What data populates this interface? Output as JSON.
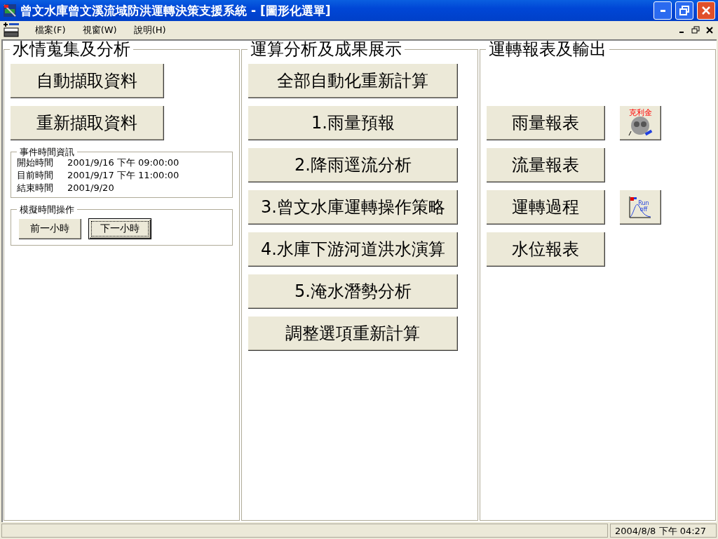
{
  "window": {
    "title": "曾文水庫曾文溪流域防洪運轉決策支援系統 - [圖形化選單]"
  },
  "menu": [
    {
      "label": "檔案(F)"
    },
    {
      "label": "視窗(W)"
    },
    {
      "label": "說明(H)"
    }
  ],
  "data_panel": {
    "title": "水情蒐集及分析",
    "buttons": [
      "自動擷取資料",
      "重新擷取資料"
    ],
    "event_info": {
      "title": "事件時間資訊",
      "rows": [
        {
          "label": "開始時間",
          "value": "2001/9/16 下午 09:00:00"
        },
        {
          "label": "目前時間",
          "value": "2001/9/17 下午 11:00:00"
        },
        {
          "label": "結束時間",
          "value": "2001/9/20"
        }
      ]
    },
    "simulation": {
      "title": "模擬時間操作",
      "buttons": [
        {
          "label": "前一小時",
          "focused": false
        },
        {
          "label": "下一小時",
          "focused": true
        }
      ]
    }
  },
  "analysis_panel": {
    "title": "運算分析及成果展示",
    "buttons": [
      "全部自動化重新計算",
      "1.雨量預報",
      "2.降雨逕流分析",
      "3.曾文水庫運轉操作策略",
      "4.水庫下游河道洪水演算",
      "5.淹水潛勢分析",
      "調整選項重新計算"
    ]
  },
  "report_panel": {
    "title": "運轉報表及輸出",
    "rows": [
      {
        "label": "雨量報表",
        "icon": {
          "kind": "kriging",
          "text": "克利金"
        }
      },
      {
        "label": "流量報表"
      },
      {
        "label": "運轉過程",
        "icon": {
          "kind": "runoff",
          "lines": [
            "Run",
            "off"
          ]
        }
      },
      {
        "label": "水位報表"
      }
    ]
  },
  "status_bar": {
    "time": "2004/8/8  下午 04:27"
  }
}
